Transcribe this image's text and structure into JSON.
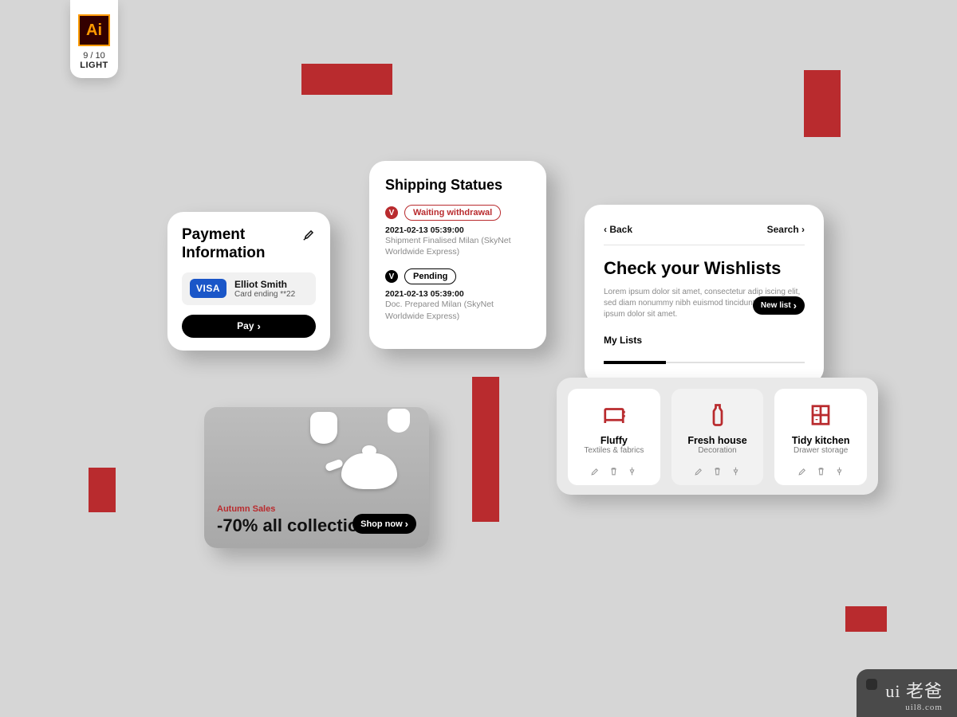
{
  "ai_badge": {
    "glyph": "Ai",
    "count": "9 / 10",
    "mode": "LIGHT"
  },
  "payment": {
    "title": "Payment Information",
    "brand": "VISA",
    "name": "Elliot Smith",
    "ending": "Card ending **22",
    "pay_label": "Pay"
  },
  "shipping": {
    "title": "Shipping Statues",
    "items": [
      {
        "badge": "V",
        "status": "Waiting withdrawal",
        "date": "2021-02-13  05:39:00",
        "desc": "Shipment Finalised Milan (SkyNet Worldwide Express)"
      },
      {
        "badge": "V",
        "status": "Pending",
        "date": "2021-02-13  05:39:00",
        "desc": "Doc. Prepared Milan (SkyNet Worldwide Express)"
      }
    ]
  },
  "promo": {
    "tag": "Autumn Sales",
    "title": "-70% all collection",
    "button": "Shop now"
  },
  "wishlist": {
    "back": "Back",
    "search": "Search",
    "title": "Check your Wishlists",
    "newlist": "New list",
    "desc": "Lorem ipsum dolor sit amet, consectetur adip iscing elit, sed diam nonummy nibh euismod tincidunt ut Lorem ipsum dolor sit amet.",
    "sub": "My Lists",
    "tiles": [
      {
        "name": "Fluffy",
        "cat": "Textiles & fabrics"
      },
      {
        "name": "Fresh house",
        "cat": "Decoration"
      },
      {
        "name": "Tidy kitchen",
        "cat": "Drawer storage"
      }
    ]
  },
  "watermark": {
    "top": "ui 老爸",
    "bottom": "uil8.com"
  }
}
